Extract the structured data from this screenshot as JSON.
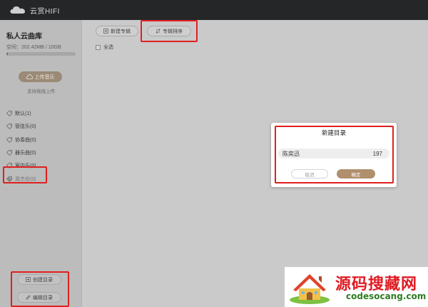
{
  "app": {
    "title": "云赏HIFI"
  },
  "sidebar": {
    "library_title": "私人云曲库",
    "space_text": "空间：202.42MB / 10GB",
    "space_used_fraction": 0.02,
    "upload_label": "上传音乐",
    "drag_hint": "支持拖拽上传",
    "categories": [
      {
        "label": "默认(1)"
      },
      {
        "label": "管弦乐(0)"
      },
      {
        "label": "协奏曲(0)"
      },
      {
        "label": "器乐曲(0)"
      },
      {
        "label": "室内乐(0)"
      },
      {
        "label": "周杰伦(0)"
      }
    ],
    "create_dir_label": "创建目录",
    "edit_dir_label": "编辑目录"
  },
  "toolbar": {
    "new_album_label": "新建专辑",
    "sort_album_label": "专辑排序",
    "select_all_label": "全选"
  },
  "dialog": {
    "title": "新建目录",
    "row_name": "陈奕迅",
    "row_count": "197",
    "cancel_label": "取消",
    "ok_label": "确定"
  },
  "watermark": {
    "chinese": "源码搜藏网",
    "domain": "codesocang.com"
  },
  "colors": {
    "topbar": "#242628",
    "accent": "#b08f6c",
    "highlight": "#e02020",
    "watermark_red": "#e01a22",
    "watermark_green": "#2e7d22"
  }
}
